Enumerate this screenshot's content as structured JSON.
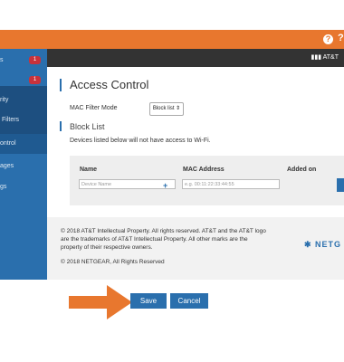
{
  "header": {
    "help_icon": "?",
    "help_icon_2": "?"
  },
  "brand": {
    "att_label": "AT&T"
  },
  "sidebar": {
    "items": [
      {
        "label": "s",
        "badge": "1"
      },
      {
        "label": "",
        "badge": "1"
      },
      {
        "label": "rity"
      },
      {
        "label": "Filters"
      },
      {
        "label": "ontrol"
      },
      {
        "label": "ages"
      },
      {
        "label": "gs"
      }
    ]
  },
  "page": {
    "title": "Access Control",
    "mac_filter_label": "MAC Filter Mode",
    "mac_filter_value": "Block list ⇕",
    "block_list_title": "Block List",
    "description": "Devices listed below will not have access to Wi-Fi.",
    "table": {
      "headers": [
        "Name",
        "MAC Address",
        "Added on"
      ],
      "name_placeholder": "Device Name",
      "mac_placeholder": "e.g. 00:11:22:33:44:55"
    }
  },
  "footer": {
    "line1": "© 2018 AT&T Intellectual Property. All rights reserved. AT&T and the AT&T logo",
    "line2": "are the trademarks of AT&T Intellectual Property. All other marks are the",
    "line3": "property of their respective owners.",
    "line4": "© 2018 NETGEAR, All Rights Reserved",
    "netgear_label": "NETG"
  },
  "actions": {
    "save_label": "Save",
    "cancel_label": "Cancel"
  },
  "colors": {
    "accent": "#e8772e",
    "primary": "#2a6fad",
    "badge": "#c8323c"
  }
}
